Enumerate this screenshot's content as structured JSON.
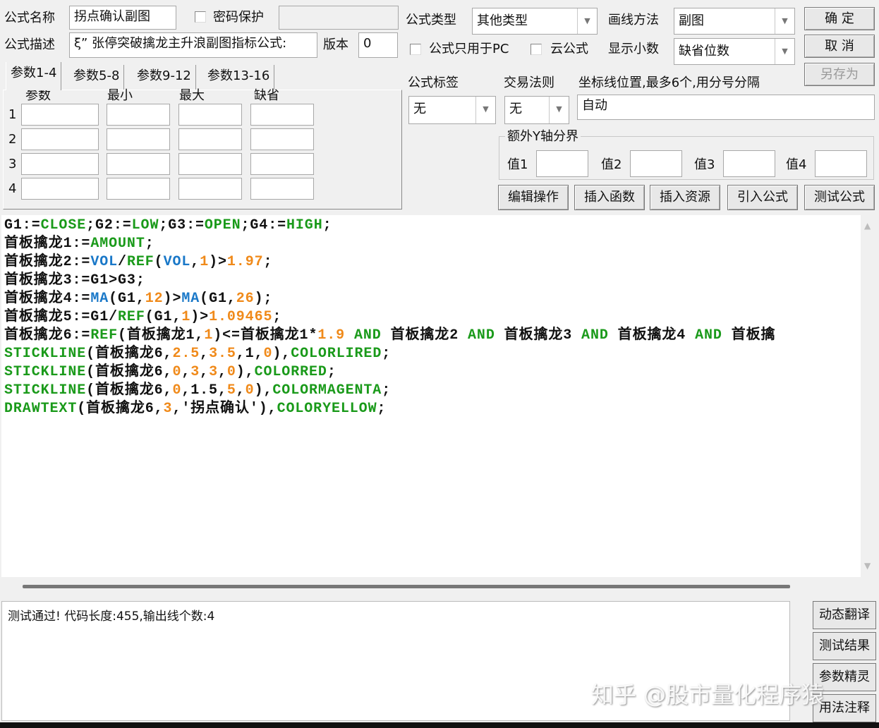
{
  "header": {
    "name_label": "公式名称",
    "name_value": "拐点确认副图",
    "password_label": "密码保护",
    "desc_label": "公式描述",
    "desc_value": "ξ” 张停突破擒龙主升浪副图指标公式:",
    "version_label": "版本",
    "version_value": "0",
    "type_label": "公式类型",
    "type_value": "其他类型",
    "draw_label": "画线方法",
    "draw_value": "副图",
    "pc_only_label": "公式只用于PC",
    "cloud_label": "云公式",
    "decimal_label": "显示小数",
    "decimal_value": "缺省位数",
    "ok_label": "确 定",
    "cancel_label": "取 消",
    "saveas_label": "另存为",
    "tag_label": "公式标签",
    "tag_value": "无",
    "trade_label": "交易法则",
    "trade_value": "无",
    "axis_label": "坐标线位置,最多6个,用分号分隔",
    "axis_value": "自动",
    "ybound_label": "额外Y轴分界",
    "values": [
      "值1",
      "值2",
      "值3",
      "值4"
    ]
  },
  "tabs": [
    "参数1-4",
    "参数5-8",
    "参数9-12",
    "参数13-16"
  ],
  "param_headers": [
    "参数",
    "最小",
    "最大",
    "缺省"
  ],
  "param_rows": [
    "1",
    "2",
    "3",
    "4"
  ],
  "toolbar": [
    "编辑操作",
    "插入函数",
    "插入资源",
    "引入公式",
    "测试公式"
  ],
  "code": [
    [
      [
        "G1:=",
        "k"
      ],
      [
        "CLOSE",
        "g"
      ],
      [
        ";G2:=",
        "k"
      ],
      [
        "LOW",
        "g"
      ],
      [
        ";G3:=",
        "k"
      ],
      [
        "OPEN",
        "g"
      ],
      [
        ";G4:=",
        "k"
      ],
      [
        "HIGH",
        "g"
      ],
      [
        ";",
        "k"
      ]
    ],
    [
      [
        "首板擒龙1:=",
        "k"
      ],
      [
        "AMOUNT",
        "g"
      ],
      [
        ";",
        "k"
      ]
    ],
    [
      [
        "首板擒龙2:=",
        "k"
      ],
      [
        "VOL",
        "b"
      ],
      [
        "/",
        "k"
      ],
      [
        "REF",
        "g"
      ],
      [
        "(",
        "k"
      ],
      [
        "VOL",
        "b"
      ],
      [
        ",",
        "k"
      ],
      [
        "1",
        "o"
      ],
      [
        ")>",
        "k"
      ],
      [
        "1.97",
        "o"
      ],
      [
        ";",
        "k"
      ]
    ],
    [
      [
        "首板擒龙3:=G1>G3;",
        "k"
      ]
    ],
    [
      [
        "首板擒龙4:=",
        "k"
      ],
      [
        "MA",
        "b"
      ],
      [
        "(G1,",
        "k"
      ],
      [
        "12",
        "o"
      ],
      [
        ")>",
        "k"
      ],
      [
        "MA",
        "b"
      ],
      [
        "(G1,",
        "k"
      ],
      [
        "26",
        "o"
      ],
      [
        ");",
        "k"
      ]
    ],
    [
      [
        "首板擒龙5:=G1/",
        "k"
      ],
      [
        "REF",
        "g"
      ],
      [
        "(G1,",
        "k"
      ],
      [
        "1",
        "o"
      ],
      [
        ")>",
        "k"
      ],
      [
        "1.09465",
        "o"
      ],
      [
        ";",
        "k"
      ]
    ],
    [
      [
        "首板擒龙6:=",
        "k"
      ],
      [
        "REF",
        "g"
      ],
      [
        "(首板擒龙1,",
        "k"
      ],
      [
        "1",
        "o"
      ],
      [
        ")<=首板擒龙1*",
        "k"
      ],
      [
        "1.9",
        "o"
      ],
      [
        " AND ",
        "g"
      ],
      [
        "首板擒龙2",
        "k"
      ],
      [
        " AND ",
        "g"
      ],
      [
        "首板擒龙3",
        "k"
      ],
      [
        " AND ",
        "g"
      ],
      [
        "首板擒龙4",
        "k"
      ],
      [
        " AND ",
        "g"
      ],
      [
        "首板擒",
        "k"
      ]
    ],
    [
      [
        "STICKLINE",
        "g"
      ],
      [
        "(首板擒龙6,",
        "k"
      ],
      [
        "2.5",
        "o"
      ],
      [
        ",",
        "k"
      ],
      [
        "3.5",
        "o"
      ],
      [
        ",1,",
        "k"
      ],
      [
        "0",
        "o"
      ],
      [
        "),",
        "k"
      ],
      [
        "COLORLIRED",
        "g"
      ],
      [
        ";",
        "k"
      ]
    ],
    [
      [
        "STICKLINE",
        "g"
      ],
      [
        "(首板擒龙6,",
        "k"
      ],
      [
        "0",
        "o"
      ],
      [
        ",",
        "k"
      ],
      [
        "3",
        "o"
      ],
      [
        ",",
        "k"
      ],
      [
        "3",
        "o"
      ],
      [
        ",",
        "k"
      ],
      [
        "0",
        "o"
      ],
      [
        "),",
        "k"
      ],
      [
        "COLORRED",
        "g"
      ],
      [
        ";",
        "k"
      ]
    ],
    [
      [
        "STICKLINE",
        "g"
      ],
      [
        "(首板擒龙6,",
        "k"
      ],
      [
        "0",
        "o"
      ],
      [
        ",1.5,",
        "k"
      ],
      [
        "5",
        "o"
      ],
      [
        ",",
        "k"
      ],
      [
        "0",
        "o"
      ],
      [
        "),",
        "k"
      ],
      [
        "COLORMAGENTA",
        "g"
      ],
      [
        ";",
        "k"
      ]
    ],
    [
      [
        "DRAWTEXT",
        "g"
      ],
      [
        "(首板擒龙6,",
        "k"
      ],
      [
        "3",
        "o"
      ],
      [
        ",'拐点确认'),",
        "k"
      ],
      [
        "COLORYELLOW",
        "g"
      ],
      [
        ";",
        "k"
      ]
    ]
  ],
  "output": {
    "text": "测试通过! 代码长度:455,输出线个数:4"
  },
  "side_buttons": [
    "动态翻译",
    "测试结果",
    "参数精灵",
    "用法注释"
  ],
  "watermark": "知乎 @股市量化程序猿"
}
